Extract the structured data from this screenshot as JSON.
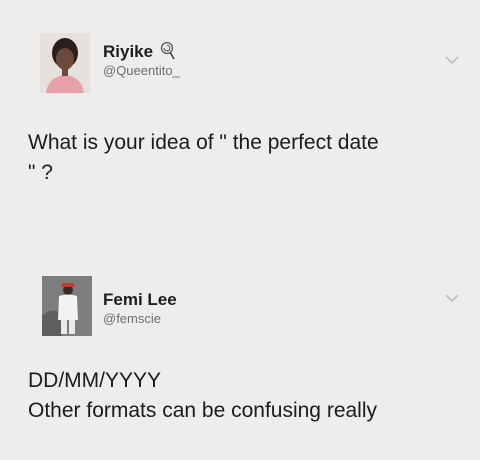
{
  "tweets": [
    {
      "name": "Riyike",
      "handle": "@Queentito_",
      "lines": [
        "What is your idea of \" the perfect date",
        "\" ?"
      ],
      "emoji_icon": "lollipop-icon"
    },
    {
      "name": "Femi Lee",
      "handle": "@femscie",
      "lines": [
        "DD/MM/YYYY",
        "Other formats can be confusing really"
      ]
    }
  ],
  "colors": {
    "background": "#ededed",
    "text": "#1b1b1b",
    "handle": "#6e6e6e"
  }
}
